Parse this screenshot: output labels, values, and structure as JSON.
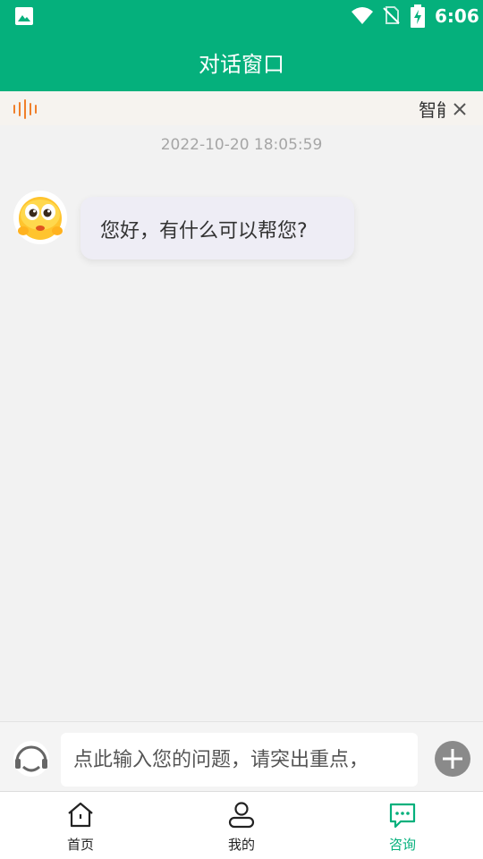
{
  "status_bar": {
    "time": "6:06",
    "icons": [
      "image-icon",
      "wifi-icon",
      "no-sim-icon",
      "battery-charging-icon"
    ]
  },
  "header": {
    "title": "对话窗口"
  },
  "notice": {
    "text": "智能",
    "icons": [
      "audio-wave-icon",
      "close-icon"
    ],
    "accent_color": "#f07f2a"
  },
  "chat": {
    "timestamp": "2022-10-20 18:05:59",
    "messages": [
      {
        "sender": "bot",
        "avatar_icon": "emoji-avatar-icon",
        "text": "您好，有什么可以帮您?"
      }
    ]
  },
  "input_bar": {
    "placeholder": "点此输入您的问题，请突出重点，",
    "value": "",
    "icons": [
      "headset-icon",
      "plus-icon"
    ]
  },
  "tab_bar": {
    "items": [
      {
        "label": "首页",
        "icon": "home-icon",
        "active": false
      },
      {
        "label": "我的",
        "icon": "user-icon",
        "active": false
      },
      {
        "label": "咨询",
        "icon": "chat-icon",
        "active": true
      }
    ]
  },
  "colors": {
    "brand": "#05b07c",
    "background": "#f2f2f2",
    "bubble": "#eeedf5",
    "timestamp": "#a6a6a6"
  }
}
